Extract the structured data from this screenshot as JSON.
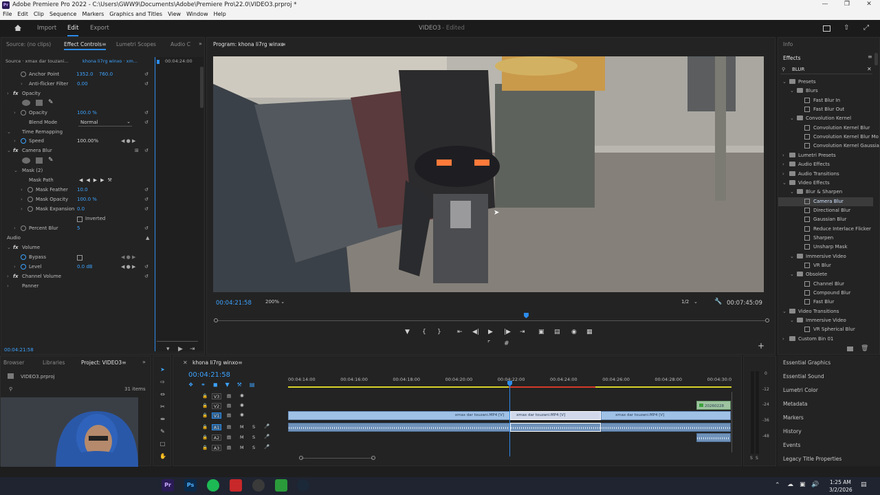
{
  "window": {
    "title": "Adobe Premiere Pro 2022 - C:\\Users\\GWW9\\Documents\\Adobe\\Premiere Pro\\22.0\\VIDEO3.prproj *",
    "app_badge": "Pr"
  },
  "menu": [
    "File",
    "Edit",
    "Clip",
    "Sequence",
    "Markers",
    "Graphics and Titles",
    "View",
    "Window",
    "Help"
  ],
  "workspace": {
    "tabs": [
      "Import",
      "Edit",
      "Export"
    ],
    "active": "Edit",
    "project_name": "VIDEO3",
    "status": "- Edited"
  },
  "effect_controls": {
    "tabs": [
      "Source: (no clips)",
      "Effect Controls",
      "Lumetri Scopes",
      "Audio C"
    ],
    "source": "Source · xmax dar touzani...",
    "clip": "khona li7rg winxo · xm...",
    "timecode_top": "00:04:24:00",
    "rows": {
      "anchor_point": {
        "label": "Anchor Point",
        "x": "1352.0",
        "y": "760.0"
      },
      "anti_flicker": {
        "label": "Anti-flicker Filter",
        "value": "0.00"
      },
      "opacity_section": "Opacity",
      "opacity": {
        "label": "Opacity",
        "value": "100.0 %"
      },
      "blend_mode": {
        "label": "Blend Mode",
        "value": "Normal"
      },
      "time_remapping": "Time Remapping",
      "speed": {
        "label": "Speed",
        "value": "100.00%"
      },
      "camera_blur": "Camera Blur",
      "mask": "Mask (2)",
      "mask_path": "Mask Path",
      "mask_feather": {
        "label": "Mask Feather",
        "value": "10.0"
      },
      "mask_opacity": {
        "label": "Mask Opacity",
        "value": "100.0 %"
      },
      "mask_expansion": {
        "label": "Mask Expansion",
        "value": "0.0"
      },
      "inverted": "Inverted",
      "percent_blur": {
        "label": "Percent Blur",
        "value": "5"
      },
      "audio": "Audio",
      "volume": "Volume",
      "bypass": "Bypass",
      "level": {
        "label": "Level",
        "value": "0.0 dB"
      },
      "channel_volume": "Channel Volume",
      "panner": "Panner"
    },
    "timecode_bottom": "00:04:21:58"
  },
  "program": {
    "title": "Program: khona li7rg winxo",
    "timecode": "00:04:21:58",
    "zoom": "200%",
    "resolution": "1/2",
    "duration": "00:07:45:09",
    "playhead_fraction": 0.562
  },
  "effects_panel": {
    "info_tab": "Info",
    "title": "Effects",
    "search": "BLUR",
    "tree": [
      {
        "label": "Presets",
        "indent": 0,
        "type": "folder"
      },
      {
        "label": "Blurs",
        "indent": 1,
        "type": "folder"
      },
      {
        "label": "Fast Blur In",
        "indent": 2,
        "type": "item"
      },
      {
        "label": "Fast Blur Out",
        "indent": 2,
        "type": "item"
      },
      {
        "label": "Convolution Kernel",
        "indent": 1,
        "type": "folder"
      },
      {
        "label": "Convolution Kernel Blur",
        "indent": 2,
        "type": "item"
      },
      {
        "label": "Convolution Kernel Blur Mo",
        "indent": 2,
        "type": "item"
      },
      {
        "label": "Convolution Kernel Gaussia",
        "indent": 2,
        "type": "item"
      },
      {
        "label": "Lumetri Presets",
        "indent": 0,
        "type": "folder"
      },
      {
        "label": "Audio Effects",
        "indent": 0,
        "type": "folder"
      },
      {
        "label": "Audio Transitions",
        "indent": 0,
        "type": "folder"
      },
      {
        "label": "Video Effects",
        "indent": 0,
        "type": "folder"
      },
      {
        "label": "Blur & Sharpen",
        "indent": 1,
        "type": "folder"
      },
      {
        "label": "Camera Blur",
        "indent": 2,
        "type": "item",
        "selected": true
      },
      {
        "label": "Directional Blur",
        "indent": 2,
        "type": "item"
      },
      {
        "label": "Gaussian Blur",
        "indent": 2,
        "type": "item"
      },
      {
        "label": "Reduce Interlace Flicker",
        "indent": 2,
        "type": "item"
      },
      {
        "label": "Sharpen",
        "indent": 2,
        "type": "item"
      },
      {
        "label": "Unsharp Mask",
        "indent": 2,
        "type": "item"
      },
      {
        "label": "Immersive Video",
        "indent": 1,
        "type": "folder"
      },
      {
        "label": "VR Blur",
        "indent": 2,
        "type": "item"
      },
      {
        "label": "Obsolete",
        "indent": 1,
        "type": "folder"
      },
      {
        "label": "Channel Blur",
        "indent": 2,
        "type": "item"
      },
      {
        "label": "Compound Blur",
        "indent": 2,
        "type": "item"
      },
      {
        "label": "Fast Blur",
        "indent": 2,
        "type": "item"
      },
      {
        "label": "Video Transitions",
        "indent": 0,
        "type": "folder"
      },
      {
        "label": "Immersive Video",
        "indent": 1,
        "type": "folder"
      },
      {
        "label": "VR Spherical Blur",
        "indent": 2,
        "type": "item"
      },
      {
        "label": "Custom Bin 01",
        "indent": 0,
        "type": "folder"
      }
    ],
    "links": [
      "Essential Graphics",
      "Essential Sound",
      "Lumetri Color",
      "Metadata",
      "Markers",
      "History",
      "Events",
      "Legacy Title Properties"
    ]
  },
  "project": {
    "tabs": [
      "Browser",
      "Libraries",
      "Project: VIDEO3"
    ],
    "file": "VIDEO3.prproj",
    "count": "31 items"
  },
  "timeline": {
    "tab": "khona li7rg winxo",
    "timecode": "00:04:21:58",
    "ruler": [
      "00:04:14:00",
      "00:04:16:00",
      "00:04:18:00",
      "00:04:20:00",
      "00:04:22:00",
      "00:04:24:00",
      "00:04:26:00",
      "00:04:28:00",
      "00:04:30:0"
    ],
    "tracks_video": [
      "V3",
      "V2",
      "V1"
    ],
    "tracks_audio": [
      "A1",
      "A2",
      "A3"
    ],
    "track_m": "M",
    "track_s": "S",
    "clips": {
      "v1_a": "xmax dar touzani.MP4 [V]",
      "v1_b": "xmax dar touzani.MP4 [V]",
      "v1_c": "xmax dar touzani.MP4 [V]",
      "v2": "20260228"
    }
  },
  "meter": [
    "0",
    "-12",
    "-24",
    "-36",
    "-48"
  ],
  "meter_s": [
    "S",
    "S"
  ],
  "taskbar": {
    "time": "1:25 AM",
    "date": "3/2/2026",
    "apps": [
      "Pr",
      "Ps"
    ]
  }
}
